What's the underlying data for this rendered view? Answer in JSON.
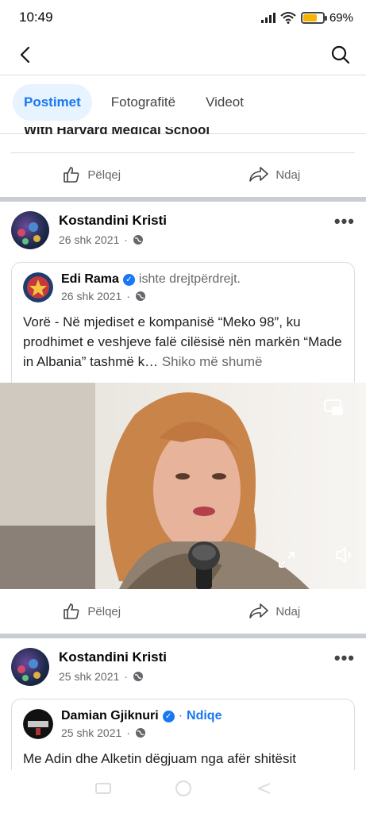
{
  "status": {
    "time": "10:49",
    "battery": "69%",
    "battery_level": 0.69
  },
  "nav": {
    "back_icon": "back-arrow-icon",
    "search_icon": "search-icon"
  },
  "tabs": [
    {
      "label": "Postimet",
      "active": true
    },
    {
      "label": "Fotografitë",
      "active": false
    },
    {
      "label": "Videot",
      "active": false
    }
  ],
  "prev_post": {
    "clipped_text": "With Harvard Medical School",
    "like": "Pëlqej",
    "share": "Ndaj"
  },
  "post1": {
    "author": "Kostandini Kristi",
    "date": "26 shk 2021",
    "shared": {
      "author": "Edi Rama",
      "suffix": "ishte drejtpërdrejt.",
      "date": "26 shk 2021",
      "text": "Vorë - Në mjediset e kompanisë “Meko 98”, ku prodhimet e veshjeve falë cilësisë nën markën “Made in Albania” tashmë k…",
      "see_more": "Shiko më shumë"
    },
    "like": "Pëlqej",
    "share": "Ndaj"
  },
  "post2": {
    "author": "Kostandini Kristi",
    "date": "25 shk 2021",
    "shared": {
      "author": "Damian Gjiknuri",
      "follow": "Ndiqe",
      "date": "25 shk 2021",
      "text": "Me Adin dhe Alketin dëgjuam nga afër shitësit"
    }
  },
  "more_glyph": "•••"
}
